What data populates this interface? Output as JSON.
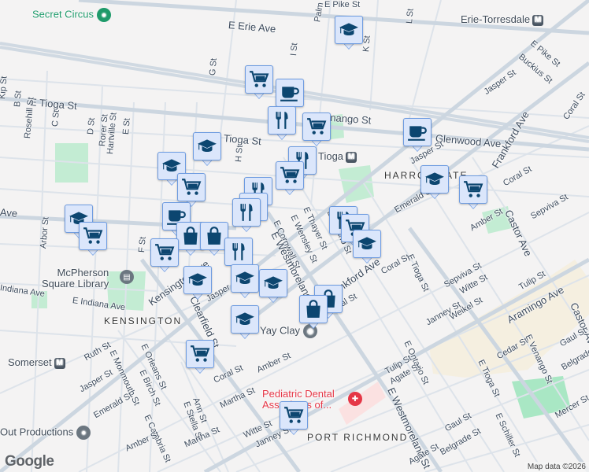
{
  "map": {
    "streets": {
      "erie": "E Erie Ave",
      "pike_top": "E Pike St",
      "palm": "Palm",
      "l_st": "L St",
      "k_st": "K St",
      "i_st": "I St",
      "g_st": "G St",
      "h_st": "H St",
      "tioga_w": "E Tioga St",
      "tioga_mid": "E Tioga St",
      "venango": "E Venango St",
      "glenwood": "Glenwood Ave",
      "jasper_ne": "Jasper St",
      "jasper_mid": "Jasper St",
      "jasper_w": "Jasper St",
      "jasper_c": "Jasper St",
      "buckius": "Buckius St",
      "pike_e": "E Pike St",
      "coral_ne": "Coral St",
      "coral_e": "Coral St",
      "coral_mid": "Coral St",
      "coral_c": "Coral St",
      "coral_s": "Coral St",
      "frankford": "Frankford Ave",
      "frankford_s": "Frankford Ave",
      "castor": "Castor Ave",
      "castor_s": "Castor Ave",
      "emerald": "Emerald St",
      "emerald_w": "Emerald St",
      "amber_e": "Amber St",
      "amber_s": "Amber St",
      "amber_sw": "Amber St",
      "sepviva_e": "Sepviva St",
      "sepviva": "Sepviva St",
      "witte": "Witte St",
      "witte_s": "Witte St",
      "tulip": "Tulip St",
      "tulip_s": "Tulip St",
      "janney": "Janney St",
      "janney_s": "Janney St",
      "weikel": "Weikel St",
      "aramingo": "Aramingo Ave",
      "cedar": "Cedar St",
      "gaul_e": "Gaul St",
      "gaul": "Gaul St",
      "belgrade_e": "Belgrade St",
      "belgrade": "Belgrade St",
      "mercer": "Mercer St",
      "e_venango_s": "E Venango St",
      "e_tioga_s": "E Tioga St",
      "e_tioga_c": "E Tioga St",
      "e_ontario_s": "E Ontario St",
      "agate": "Agate St",
      "agate_s": "Agate St",
      "westmoreland": "E Westmoreland St",
      "westmoreland_s": "E Westmoreland St",
      "e_schiller": "E Schiller St",
      "kip": "Kip St",
      "b_st": "B St",
      "rosehill": "Rosehill St",
      "c_st": "C St",
      "d_st": "D St",
      "rorer": "Rorer St",
      "hartville": "Hartville St",
      "e_st": "E St",
      "f_st": "F St",
      "arbor": "Arbor St",
      "indiana": "E Indiana Ave",
      "indiana_w": "Indiana Ave",
      "ave_w": "Ave",
      "kensington": "Kensington Ave",
      "clearfield": "Clearfield St",
      "ruth": "Ruth St",
      "monmouth": "E Monmouth St",
      "orleans": "E Orleans St",
      "birch": "E Birch St",
      "ann": "Ann St",
      "stella": "E Stella St",
      "martha": "Martha St",
      "martha_s": "Martha St",
      "cambria": "E Cambria St",
      "e_ontario": "E Ontario St",
      "e_thayer": "E Thayer St",
      "e_wensley": "E Wensley St",
      "e_cornwall": "E Cornwall St"
    },
    "neighborhoods": {
      "harrowgate": "HARROWGATE",
      "kensington": "KENSINGTON",
      "port_richmond": "PORT RICHMOND"
    },
    "transit": {
      "erie_torresdale": "Erie-Torresdale",
      "tioga": "Tioga",
      "somerset": "Somerset",
      "metro_glyph": "M"
    },
    "places": {
      "secret_circus": "Secret Circus",
      "library_line1": "McPherson",
      "library_line2": "Square Library",
      "yay_clay": "Yay Clay",
      "pediatric_line1": "Pediatric Dental",
      "pediatric_line2": "Associates of...",
      "out_productions": "Out Productions"
    },
    "markers": [
      "education",
      "shopping-cart",
      "coffee",
      "restaurant",
      "shopping-cart",
      "coffee",
      "education",
      "education",
      "restaurant",
      "shopping-cart",
      "shopping-cart",
      "restaurant",
      "restaurant",
      "restaurant",
      "education",
      "shopping-cart",
      "coffee",
      "education",
      "shopping-cart",
      "restaurant",
      "shopping-cart",
      "education",
      "shopping-bag",
      "shopping-bag",
      "shopping-cart",
      "restaurant",
      "education",
      "education",
      "education",
      "education",
      "shopping-bag",
      "shopping-bag",
      "shopping-cart",
      "shopping-cart"
    ],
    "google_logo": "Google",
    "attribution": "Map data ©2026",
    "colors": {
      "marker_fill": "#dbe6fb",
      "marker_border": "#6d9be0",
      "icon": "#0c4670",
      "park": "#c3ecd3",
      "commercial": "#f5efe0",
      "medical": "#fbe1e1"
    }
  }
}
